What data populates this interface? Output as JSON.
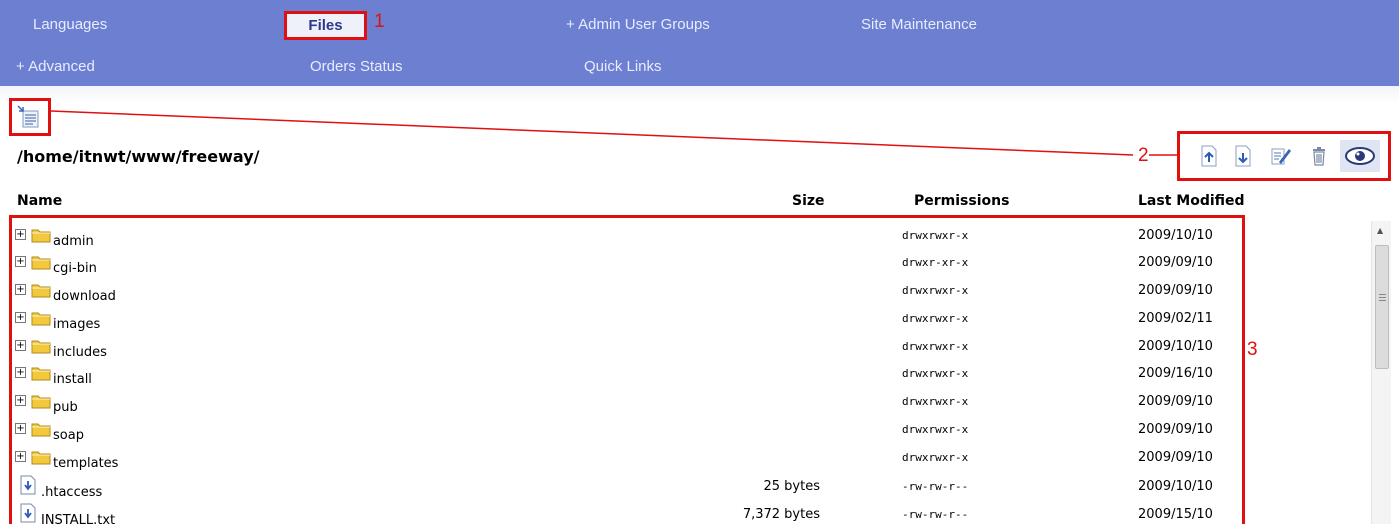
{
  "nav": {
    "row1": [
      "Languages",
      "Files",
      "+  Admin User Groups",
      "Site Maintenance"
    ],
    "row2": [
      "+  Advanced",
      "Orders Status",
      "Quick Links"
    ]
  },
  "annotations": {
    "one": "1",
    "two": "2",
    "three": "3"
  },
  "path": "/home/itnwt/www/freeway/",
  "columns": {
    "name": "Name",
    "size": "Size",
    "permissions": "Permissions",
    "modified": "Last Modified"
  },
  "toolbar_icons": [
    "upload-icon",
    "download-icon",
    "edit-icon",
    "delete-icon",
    "view-icon"
  ],
  "colors": {
    "nav_bg": "#6d7fd0",
    "highlight": "#e01010",
    "folder": "#f2c83c"
  },
  "rows": [
    {
      "name": "admin",
      "size": "",
      "perm": "drwxrwxr-x",
      "mod": "2009/10/10",
      "type": "folder"
    },
    {
      "name": "cgi-bin",
      "size": "",
      "perm": "drwxr-xr-x",
      "mod": "2009/09/10",
      "type": "folder"
    },
    {
      "name": "download",
      "size": "",
      "perm": "drwxrwxr-x",
      "mod": "2009/09/10",
      "type": "folder"
    },
    {
      "name": "images",
      "size": "",
      "perm": "drwxrwxr-x",
      "mod": "2009/02/11",
      "type": "folder"
    },
    {
      "name": "includes",
      "size": "",
      "perm": "drwxrwxr-x",
      "mod": "2009/10/10",
      "type": "folder"
    },
    {
      "name": "install",
      "size": "",
      "perm": "drwxrwxr-x",
      "mod": "2009/16/10",
      "type": "folder"
    },
    {
      "name": "pub",
      "size": "",
      "perm": "drwxrwxr-x",
      "mod": "2009/09/10",
      "type": "folder"
    },
    {
      "name": "soap",
      "size": "",
      "perm": "drwxrwxr-x",
      "mod": "2009/09/10",
      "type": "folder"
    },
    {
      "name": "templates",
      "size": "",
      "perm": "drwxrwxr-x",
      "mod": "2009/09/10",
      "type": "folder"
    },
    {
      "name": ".htaccess",
      "size": "25 bytes",
      "perm": "-rw-rw-r--",
      "mod": "2009/10/10",
      "type": "file"
    },
    {
      "name": "INSTALL.txt",
      "size": "7,372 bytes",
      "perm": "-rw-rw-r--",
      "mod": "2009/15/10",
      "type": "file"
    }
  ]
}
